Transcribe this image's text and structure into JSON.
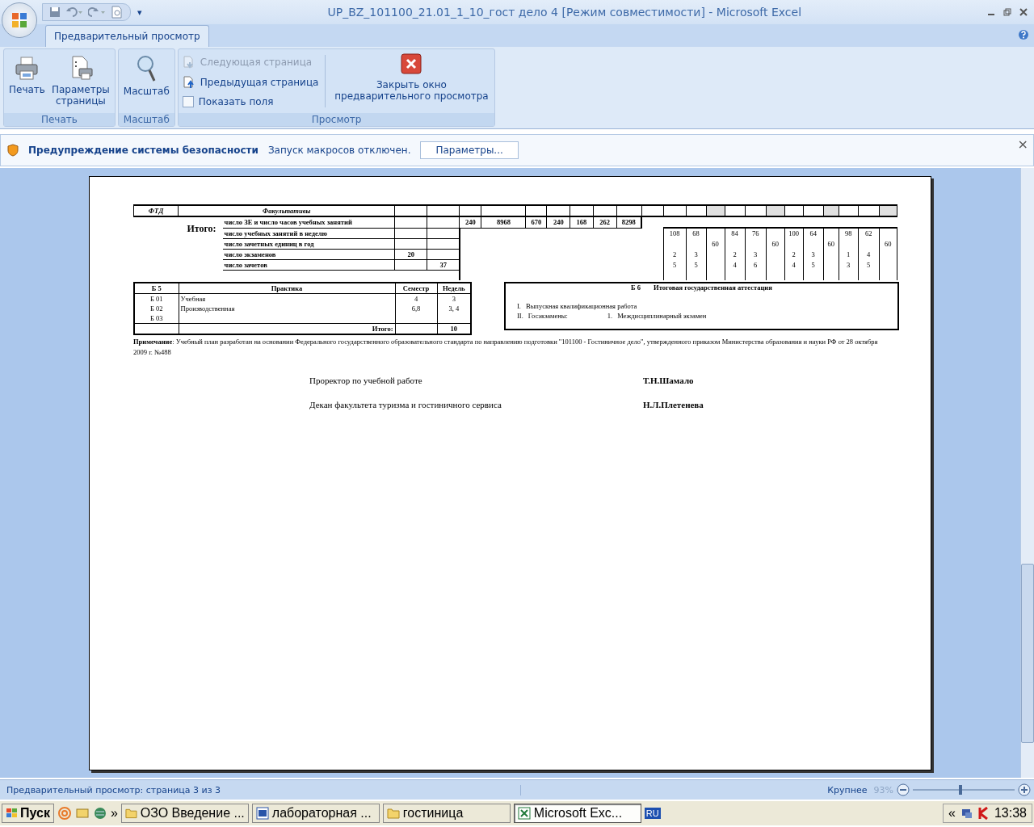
{
  "window": {
    "title": "UP_BZ_101100_21.01_1_10_гост дело 4  [Режим совместимости] - Microsoft Excel",
    "more_glyph": "▾"
  },
  "ribbon": {
    "tabs": [
      {
        "label": "Предварительный просмотр",
        "selected": true
      }
    ],
    "groups": [
      {
        "label": "Печать",
        "kind": "large",
        "buttons": [
          {
            "label": "Печать"
          },
          {
            "label": "Параметры страницы"
          }
        ]
      },
      {
        "label": "Масштаб",
        "kind": "large",
        "buttons": [
          {
            "label": "Масштаб"
          }
        ]
      },
      {
        "label": "Просмотр",
        "kind": "view",
        "items": [
          {
            "label": "Следующая страница",
            "kind": "button",
            "disabled": true
          },
          {
            "label": "Предыдущая страница",
            "kind": "button",
            "disabled": false
          },
          {
            "label": "Показать поля",
            "kind": "checkbox",
            "checked": false
          }
        ],
        "close_button": "Закрыть окно предварительного просмотра"
      }
    ]
  },
  "security_bar": {
    "title": "Предупреждение системы безопасности",
    "message": "Запуск макросов отключен.",
    "button": "Параметры...",
    "close": "×"
  },
  "document": {
    "summary_table": {
      "header": {
        "code": "ФТД",
        "title": "Факультативы",
        "shaded": [
          false,
          false,
          true,
          false,
          false,
          true,
          false,
          false,
          true,
          false,
          false,
          true
        ]
      },
      "totals_label": "Итого:",
      "rows": [
        {
          "label": "число ЗЕ и число часов учебных занятий",
          "mid": [
            "240",
            "8968",
            "670",
            "240",
            "168",
            "262",
            "8298"
          ]
        },
        {
          "label": "число учебных занятий в неделю",
          "groups": [
            {
              "column_1": "108",
              "column_2": "68"
            },
            {
              "column_1": "84",
              "column_2": "76"
            },
            {
              "column_1": "100",
              "column_2": "64"
            },
            {
              "column_1": "98",
              "column_2": "62"
            }
          ]
        },
        {
          "label": "число зачетных единиц в год",
          "groups": [
            {
              "column_3": "60"
            },
            {
              "column_3": "60"
            },
            {
              "column_3": "60"
            },
            {
              "column_3": "60"
            }
          ]
        },
        {
          "label": "число экзаменов",
          "left": {
            "column_1": "20"
          },
          "groups": [
            {
              "column_1": "2",
              "column_2": "3"
            },
            {
              "column_1": "2",
              "column_2": "3"
            },
            {
              "column_1": "2",
              "column_2": "3"
            },
            {
              "column_1": "1",
              "column_2": "4"
            }
          ]
        },
        {
          "label": "число зачетов",
          "left": {
            "column_2": "37"
          },
          "groups": [
            {
              "column_1": "5",
              "column_2": "5"
            },
            {
              "column_1": "4",
              "column_2": "6"
            },
            {
              "column_1": "4",
              "column_2": "5"
            },
            {
              "column_1": "3",
              "column_2": "5"
            }
          ]
        }
      ]
    },
    "practice": {
      "columns": [
        "Б 5",
        "Практика",
        "Семестр",
        "Недель"
      ],
      "rows": [
        {
          "code": "Б 01",
          "name": "Учебная",
          "semester": "4",
          "weeks": "3"
        },
        {
          "code": "Б 02",
          "name": "Производственная",
          "semester": "6,8",
          "weeks": "3, 4"
        },
        {
          "code": "Б 03"
        }
      ],
      "total_label": "Итого:",
      "total": "10"
    },
    "attestation": {
      "code": "Б 6",
      "title": "Итоговая государственная аттестация",
      "items": [
        {
          "number": "I.",
          "text": "Выпускная квалификационная работа"
        },
        {
          "number": "II.",
          "text": "Госэкзамены:",
          "sub_number": "1.",
          "sub_text": "Междисциплинарный экзамен"
        }
      ]
    },
    "note": "**Примечание**: Учебный план разработан на основании Федерального государственного образовательного стандарта по направлению подготовки \"101100 - Гостиничное дело\", утвержденного приказом Министерства образования и науки РФ от 28 октября 2009 г. №488",
    "signatures": [
      {
        "role": "Проректор по учебной работе",
        "name": "Т.Н.Шамало"
      },
      {
        "role": "Декан факультета туризма и гостиничного сервиса",
        "name": "Н.Л.Плетенева"
      }
    ]
  },
  "status_bar": {
    "text": "Предварительный просмотр: страница 3 из 3",
    "zoom_label": "Крупнее",
    "zoom": "93%",
    "zoom_disabled": true,
    "level": 0.47
  },
  "taskbar": {
    "start": "Пуск",
    "more": "»",
    "tasks": [
      {
        "label": "ОЗО Введение ...",
        "selected": false
      },
      {
        "label": "лабораторная ...",
        "selected": false
      },
      {
        "label": "гостиница",
        "selected": false
      },
      {
        "label": "Microsoft Exc...",
        "selected": true
      }
    ],
    "language": "RU",
    "tray_more": "«",
    "clock": "13:38"
  }
}
